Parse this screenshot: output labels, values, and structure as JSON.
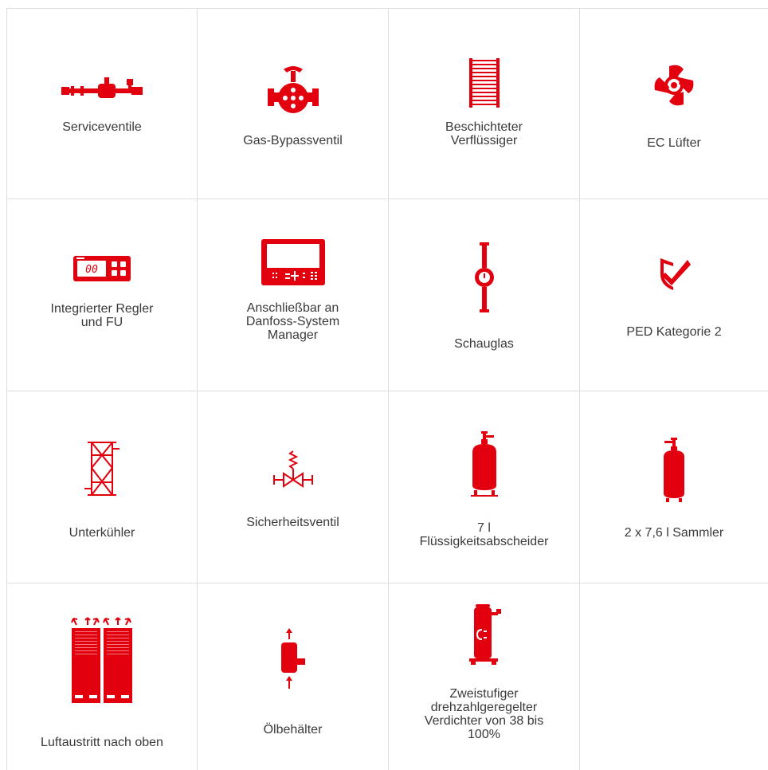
{
  "colors": {
    "accent": "#e2000f",
    "border": "#dedede",
    "text": "#3a3a3a"
  },
  "features": [
    {
      "label": "Serviceventile",
      "icon": "service-valve-icon"
    },
    {
      "label": "Gas-Bypassventil",
      "icon": "gas-bypass-valve-icon"
    },
    {
      "label": "Beschichteter\nVerflüssiger",
      "icon": "coated-condenser-icon"
    },
    {
      "label": "EC Lüfter",
      "icon": "ec-fan-icon"
    },
    {
      "label": "Integrierter Regler\nund FU",
      "icon": "controller-display-icon",
      "display_text": "00"
    },
    {
      "label": "Anschließbar an\nDanfoss-System\nManager",
      "icon": "system-manager-icon"
    },
    {
      "label": "Schauglas",
      "icon": "sight-glass-icon"
    },
    {
      "label": "PED Kategorie 2",
      "icon": "ped-shield-check-icon"
    },
    {
      "label": "Unterkühler",
      "icon": "subcooler-icon"
    },
    {
      "label": "Sicherheitsventil",
      "icon": "safety-valve-icon"
    },
    {
      "label": "7 l\nFlüssigkeitsabscheider",
      "icon": "liquid-separator-icon"
    },
    {
      "label": "2 x 7,6 l Sammler",
      "icon": "receiver-icon"
    },
    {
      "label": "Luftaustritt nach oben",
      "icon": "air-outlet-up-icon"
    },
    {
      "label": "Ölbehälter",
      "icon": "oil-reservoir-icon"
    },
    {
      "label": "Zweistufiger\ndrehzahlgeregelter\nVerdichter von 38 bis\n100%",
      "icon": "compressor-icon"
    }
  ]
}
